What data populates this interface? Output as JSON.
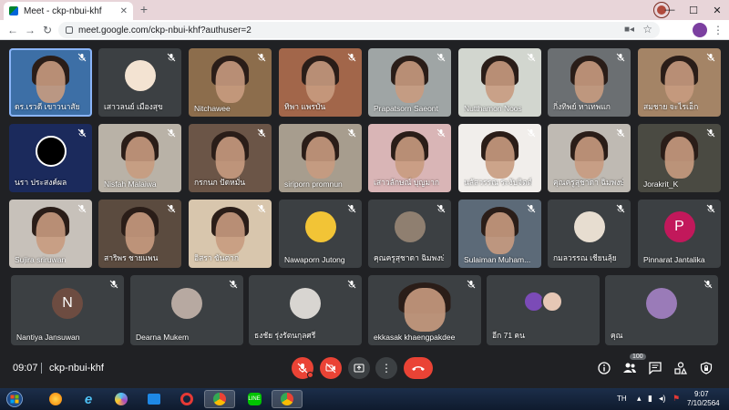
{
  "browser": {
    "tab_title": "Meet - ckp-nbui-khf",
    "url": "meet.google.com/ckp-nbui-khf?authuser=2"
  },
  "participants": [
    {
      "name": "ดร.เรวดี เขาวนาสัย",
      "bg": "#3d6fa6",
      "kind": "video",
      "active": true
    },
    {
      "name": "เสาวลนย์ เมืองสุข",
      "bg": "#3c4043",
      "kind": "avatar",
      "avatar_bg": "#f3e3d2"
    },
    {
      "name": "Nitchawee",
      "bg": "#8c6d4c",
      "kind": "video"
    },
    {
      "name": "ทิพา แพรบัน",
      "bg": "#a2664a",
      "kind": "video"
    },
    {
      "name": "Prapatsorn Saeont",
      "bg": "#9fa5a5",
      "kind": "video"
    },
    {
      "name": "Nutthamon Noos",
      "bg": "#d2d6cf",
      "kind": "video"
    },
    {
      "name": "กิ่งทิพย์ หาเทพแก",
      "bg": "#6b6f72",
      "kind": "video"
    },
    {
      "name": "สมชาย จะไรเอ็ก",
      "bg": "#a48466",
      "kind": "video"
    },
    {
      "name": "นรา ประสงค์ผล",
      "bg": "#1b2a5c",
      "kind": "logo"
    },
    {
      "name": "Nisfah Malaiwa",
      "bg": "#b9b2a7",
      "kind": "video"
    },
    {
      "name": "กรกนก ปัดหมั่น",
      "bg": "#6b5547",
      "kind": "video"
    },
    {
      "name": "siriporn promnun",
      "bg": "#a79d8e",
      "kind": "video"
    },
    {
      "name": "เสาวลักษณ์ บุญมาก",
      "bg": "#d9b5b6",
      "kind": "video"
    },
    {
      "name": "นลัสวรรณ ระงับจิตต์",
      "bg": "#f1eeeb",
      "kind": "video"
    },
    {
      "name": "คุณครูสุชาดา ฉิมพงษ์",
      "bg": "#bfbab3",
      "kind": "video"
    },
    {
      "name": "Jorakrit_K",
      "bg": "#4a4a42",
      "kind": "video"
    },
    {
      "name": "Sujira sriruwan",
      "bg": "#c7c1ba",
      "kind": "video"
    },
    {
      "name": "สาริพร ชายแพน",
      "bg": "#5b4b3f",
      "kind": "video"
    },
    {
      "name": "อิสรา ขันตาก",
      "bg": "#d8c6ad",
      "kind": "video"
    },
    {
      "name": "Nawaporn Jutong",
      "bg": "#3c4043",
      "kind": "avatar",
      "avatar_bg": "#f2c436"
    },
    {
      "name": "คุณครูสุชาดา ฉิมพงษ์",
      "bg": "#3c4043",
      "kind": "avatar",
      "avatar_bg": "#8f7f70"
    },
    {
      "name": "Sulaiman Muham...",
      "bg": "#5c6a78",
      "kind": "video"
    },
    {
      "name": "กมลวรรณ เชียนลุ้ย",
      "bg": "#3c4043",
      "kind": "avatar",
      "avatar_bg": "#e7ddd0"
    },
    {
      "name": "Pinnarat Jantalika",
      "bg": "#3c4043",
      "kind": "letter",
      "letter": "P",
      "avatar_bg": "#c2185b"
    },
    {
      "name": "Nantiya Jansuwan",
      "bg": "#3c4043",
      "kind": "letter",
      "letter": "N",
      "avatar_bg": "#6d4c41"
    },
    {
      "name": "Dearna Mukem",
      "bg": "#3c4043",
      "kind": "avatar",
      "avatar_bg": "#b7a9a1"
    },
    {
      "name": "ธงชัย รุ่งรัตนกุลศรี",
      "bg": "#3c4043",
      "kind": "avatar",
      "avatar_bg": "#d8d5d1"
    },
    {
      "name": "ekkasak khaengpakdee",
      "bg": "#3c4043",
      "kind": "video"
    },
    {
      "name": "อีก 71 คน",
      "bg": "#3c4043",
      "kind": "others"
    },
    {
      "name": "คุณ",
      "bg": "#3c4043",
      "kind": "avatar",
      "avatar_bg": "#9a7bb8"
    }
  ],
  "controls": {
    "time": "09:07",
    "meeting_code": "ckp-nbui-khf",
    "people_count": "100"
  },
  "taskbar": {
    "lang": "TH",
    "time": "9:07",
    "date": "7/10/2564"
  }
}
